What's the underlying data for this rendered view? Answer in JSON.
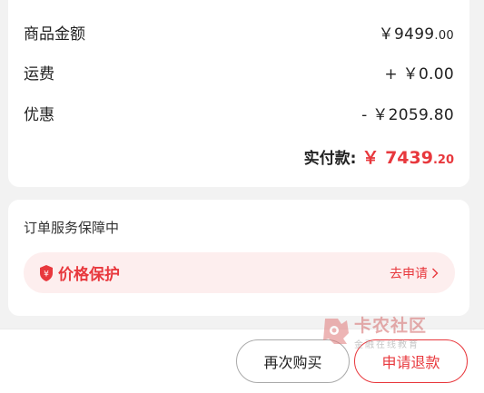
{
  "price": {
    "goods_label": "商品金额",
    "goods_value_main": "￥9499",
    "goods_value_decimal": ".00",
    "shipping_label": "运费",
    "shipping_value": "+ ￥0.00",
    "discount_label": "优惠",
    "discount_value": "- ￥2059.80",
    "actual_label": "实付款:",
    "actual_currency": "￥",
    "actual_main": "7439",
    "actual_decimal": ".20"
  },
  "service": {
    "title": "订单服务保障中",
    "item_name": "价格保护",
    "item_action": "去申请"
  },
  "actions": {
    "rebuy_label": "再次购买",
    "refund_label": "申请退款"
  },
  "watermark": {
    "title": "卡农社区",
    "subtitle": "金融在线教育"
  },
  "colors": {
    "accent": "#e8383d",
    "service_bg": "#fdeeee",
    "page_bg": "#f2f2f2"
  }
}
